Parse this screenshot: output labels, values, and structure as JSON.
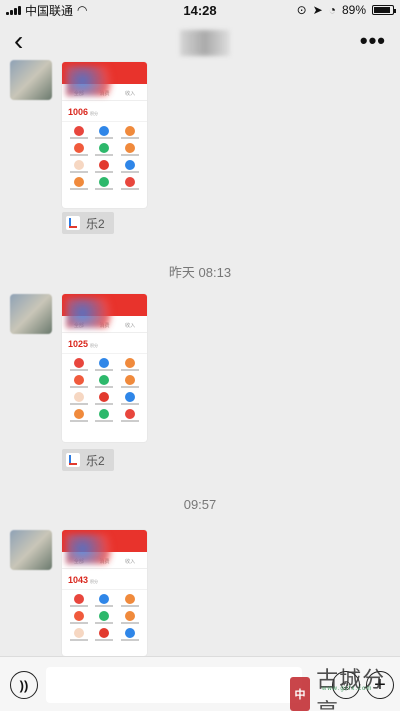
{
  "status": {
    "carrier": "中国联通",
    "time": "14:28",
    "battery": "89%",
    "battery_level": 0.89
  },
  "nav": {
    "back_icon": "chevron-left-icon",
    "more_icon": "more-icon"
  },
  "messages": [
    {
      "score": "1006",
      "unit": "积分",
      "tabs": [
        "全部",
        "消费",
        "收入"
      ],
      "card": "乐2"
    },
    {
      "timestamp": "昨天 08:13",
      "score": "1025",
      "unit": "积分",
      "tabs": [
        "全部",
        "消费",
        "收入"
      ],
      "card": "乐2"
    },
    {
      "timestamp": "09:57",
      "score": "1043",
      "unit": "积分",
      "tabs": [
        "全部",
        "消费",
        "收入"
      ]
    }
  ],
  "grid_colors": [
    "#e8463d",
    "#2f86e8",
    "#f08a3c",
    "#f05a3c",
    "#2db86b",
    "#f08a3c",
    "#f6d7c2",
    "#e23a2e",
    "#2f86e8",
    "#f08a3c",
    "#2db86b",
    "#e8463d"
  ],
  "watermark": {
    "seal": "中",
    "text": "古城分享",
    "sub": "www.gcfx.com"
  }
}
